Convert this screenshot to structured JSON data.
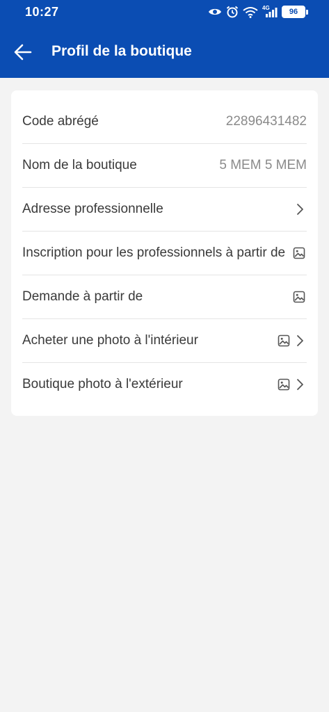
{
  "status_bar": {
    "time": "10:27",
    "battery": "96",
    "network": "4G"
  },
  "header": {
    "title": "Profil de la boutique",
    "back_icon": "arrow-left-icon"
  },
  "colors": {
    "header_bg": "#0b4db3",
    "page_bg": "#f3f3f3"
  },
  "rows": [
    {
      "label": "Code abrégé",
      "value": "22896431482"
    },
    {
      "label": "Nom de la boutique",
      "value": "5 MEM 5 MEM"
    },
    {
      "label": "Adresse professionnelle",
      "icons": [
        "chevron-right-icon"
      ]
    },
    {
      "label": "Inscription pour les professionnels à partir de",
      "icons": [
        "image-icon"
      ]
    },
    {
      "label": "Demande à partir de",
      "icons": [
        "image-icon"
      ]
    },
    {
      "label": "Acheter une photo à l'intérieur",
      "icons": [
        "image-icon",
        "chevron-right-icon"
      ]
    },
    {
      "label": "Boutique photo à l'extérieur",
      "icons": [
        "image-icon",
        "chevron-right-icon"
      ]
    }
  ]
}
